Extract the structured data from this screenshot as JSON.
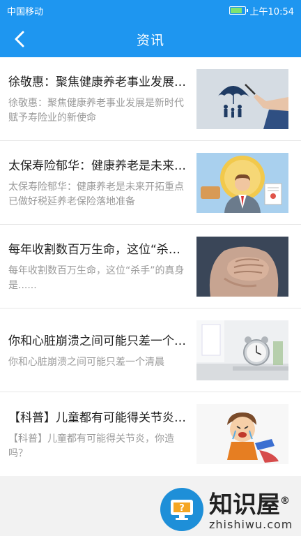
{
  "status": {
    "carrier": "中国移动",
    "time": "上午10:54"
  },
  "header": {
    "title": "资讯"
  },
  "articles": [
    {
      "title": "徐敬惠：聚焦健康养老事业发展是新时代赋予寿险业的新使命",
      "summary": "徐敬惠：聚焦健康养老事业发展是新时代赋予寿险业的新使命",
      "thumb": "umbrella-family"
    },
    {
      "title": "太保寿险郁华：健康养老是未来开拓重点 已做好税延养老保险落地准备",
      "summary": "太保寿险郁华：健康养老是未来开拓重点 已做好税延养老保险落地准备",
      "thumb": "businessman"
    },
    {
      "title": "每年收割数百万生命，这位“杀手”的真身是......",
      "summary": "每年收割数百万生命，这位“杀手”的真身是......",
      "thumb": "chest-pain"
    },
    {
      "title": "你和心脏崩溃之间可能只差一个清晨",
      "summary": "你和心脏崩溃之间可能只差一个清晨",
      "thumb": "alarm-clock"
    },
    {
      "title": "【科普】儿童都有可能得关节炎，你造吗？",
      "summary": "【科普】儿童都有可能得关节炎，你造吗？",
      "thumb": "crying-child"
    }
  ],
  "watermark": {
    "brand": "知识屋",
    "registered": "®",
    "domain": "zhishiwu.com"
  },
  "colors": {
    "primary": "#1e96f0",
    "background": "#f2f2f2",
    "title_text": "#222222",
    "summary_text": "#9a9a9a"
  }
}
